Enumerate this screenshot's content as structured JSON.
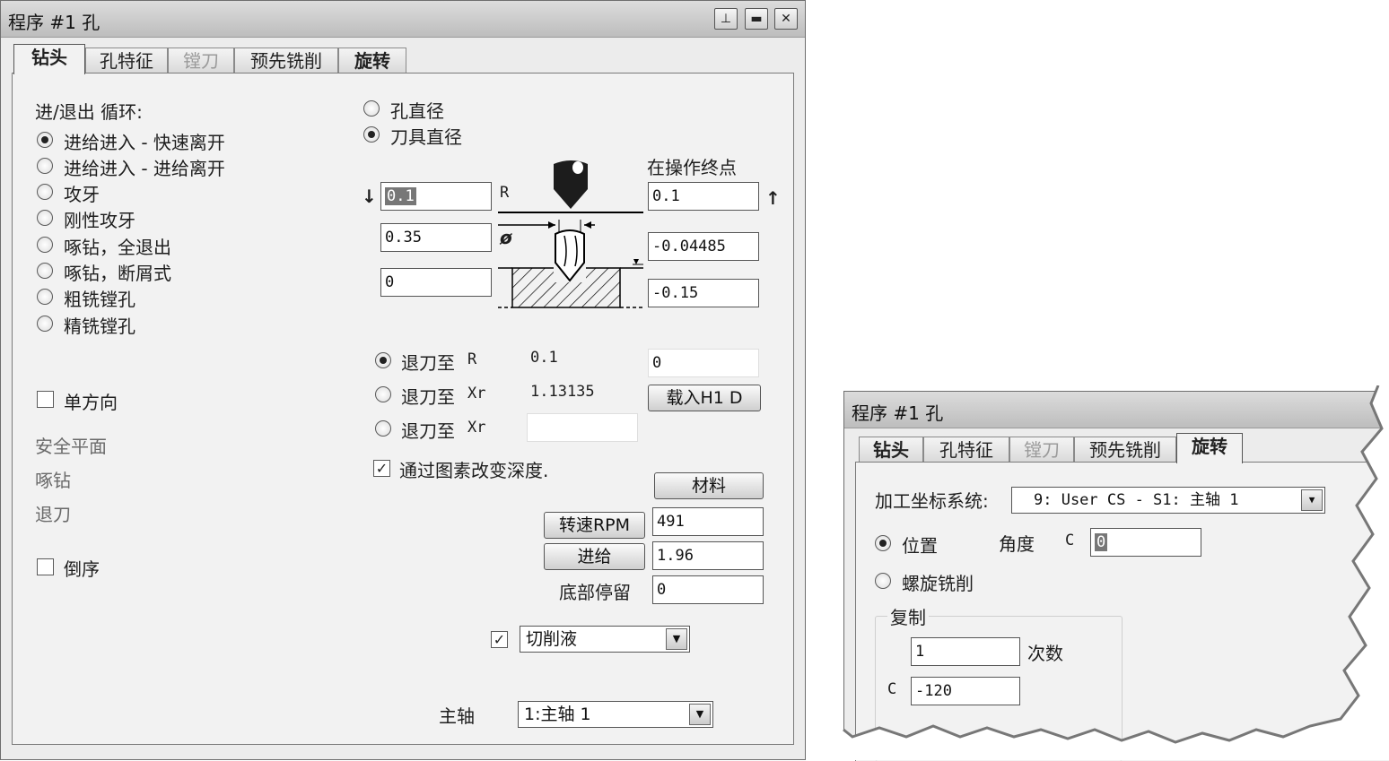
{
  "main": {
    "title": "程序 #1 孔",
    "window_buttons": [
      "pin",
      "minimize",
      "close"
    ],
    "tabs": [
      {
        "label": "钻头",
        "state": "active"
      },
      {
        "label": "孔特征",
        "state": "normal"
      },
      {
        "label": "镗刀",
        "state": "disabled"
      },
      {
        "label": "预先铣削",
        "state": "normal"
      },
      {
        "label": "旋转",
        "state": "normal"
      }
    ],
    "cycle_label": "进/退出 循环:",
    "cycles": [
      {
        "label": "进给进入 - 快速离开",
        "selected": true
      },
      {
        "label": "进给进入 - 进给离开",
        "selected": false
      },
      {
        "label": "攻牙",
        "selected": false
      },
      {
        "label": "刚性攻牙",
        "selected": false
      },
      {
        "label": "啄钻，全退出",
        "selected": false
      },
      {
        "label": "啄钻，断屑式",
        "selected": false
      },
      {
        "label": "粗铣镗孔",
        "selected": false
      },
      {
        "label": "精铣镗孔",
        "selected": false
      }
    ],
    "unidirectional": {
      "label": "单方向",
      "checked": false
    },
    "safety_plane": "安全平面",
    "peck": "啄钻",
    "retract": "退刀",
    "reverse": {
      "label": "倒序",
      "checked": false
    },
    "diameter_options": [
      {
        "label": "孔直径",
        "selected": false
      },
      {
        "label": "刀具直径",
        "selected": true
      }
    ],
    "op_end_label": "在操作终点",
    "diagram": {
      "r_label": "R",
      "dia_label": "ø"
    },
    "left_values": [
      "0.1",
      "0.35",
      "0"
    ],
    "right_values": [
      "0.1",
      "-0.04485",
      "-0.15"
    ],
    "retract_options": [
      {
        "label": "退刀至",
        "code": "R",
        "value": "0.1",
        "selected": true
      },
      {
        "label": "退刀至",
        "code": "Xr",
        "value": "1.13135",
        "selected": false
      },
      {
        "label": "退刀至",
        "code": "Xr",
        "value": "",
        "selected": false
      }
    ],
    "retract_field_value": "0",
    "load_h1d_label": "载入H1 D",
    "change_depth": {
      "label": "通过图素改变深度.",
      "checked": true
    },
    "material_label": "材料",
    "rpm_label": "转速RPM",
    "rpm_value": "491",
    "feed_label": "进给",
    "feed_value": "1.96",
    "dwell_label": "底部停留",
    "dwell_value": "0",
    "coolant": {
      "checked": true,
      "value": "切削液"
    },
    "spindle_label": "主轴",
    "spindle_value": "1:主轴 1"
  },
  "inset": {
    "title": "程序 #1 孔",
    "tabs": [
      {
        "label": "钻头",
        "state": "normal"
      },
      {
        "label": "孔特征",
        "state": "normal"
      },
      {
        "label": "镗刀",
        "state": "disabled"
      },
      {
        "label": "预先铣削",
        "state": "normal"
      },
      {
        "label": "旋转",
        "state": "active"
      }
    ],
    "wcs_label": "加工坐标系统:",
    "wcs_value": "9: User CS - S1: 主轴 1",
    "position": {
      "label": "位置",
      "selected": true
    },
    "angle_label": "角度",
    "c_label": "C",
    "angle_value": "0",
    "helical": {
      "label": "螺旋铣削",
      "selected": false
    },
    "copy_label": "复制",
    "count_value": "1",
    "count_label": "次数",
    "copy_c_label": "C",
    "copy_c_value": "-120"
  }
}
